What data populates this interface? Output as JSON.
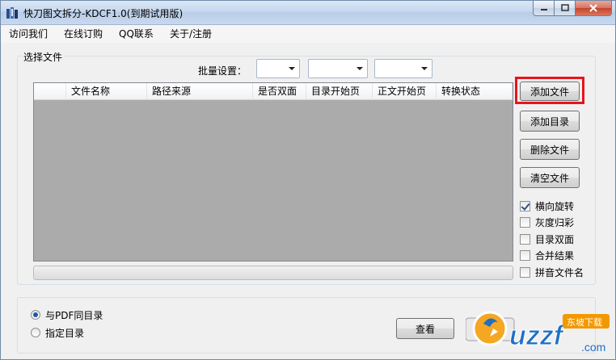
{
  "window": {
    "title": "快刀图文拆分-KDCF1.0(到期试用版)"
  },
  "menu": [
    "访问我们",
    "在线订购",
    "QQ联系",
    "关于/注册"
  ],
  "select_group": {
    "label": "选择文件",
    "batch_label": "批量设置："
  },
  "table": {
    "columns": [
      "文件名称",
      "路径来源",
      "是否双面",
      "目录开始页",
      "正文开始页",
      "转换状态"
    ]
  },
  "buttons": {
    "add_file": "添加文件",
    "add_dir": "添加目录",
    "delete_file": "删除文件",
    "clear_files": "清空文件",
    "view": "查看"
  },
  "options": [
    {
      "label": "横向旋转",
      "checked": true
    },
    {
      "label": "灰度归彩",
      "checked": false
    },
    {
      "label": "目录双面",
      "checked": false
    },
    {
      "label": "合并结果",
      "checked": false
    },
    {
      "label": "拼音文件名",
      "checked": false
    }
  ],
  "output": {
    "same_dir": "与PDF同目录",
    "custom_dir": "指定目录",
    "selected": "same_dir"
  },
  "watermark": {
    "text": "uzzf.com",
    "badge": "东坡下载"
  },
  "colors": {
    "highlight": "#e8141b",
    "list_bg": "#ababab"
  }
}
